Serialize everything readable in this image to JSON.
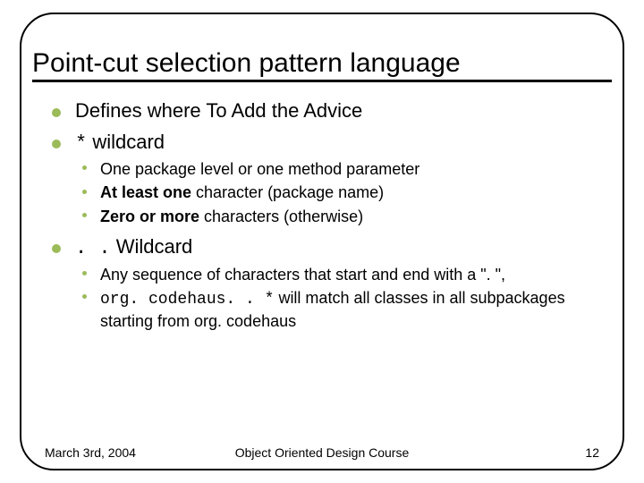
{
  "title": "Point-cut selection pattern language",
  "bullets": {
    "b1": "Defines where To Add the Advice",
    "b2_prefix_code": "*",
    "b2_rest": " wildcard",
    "b2_sub1": "One package level or one method parameter",
    "b2_sub2_strong": "At least one",
    "b2_sub2_rest": " character (package name)",
    "b2_sub3_strong": "Zero or more",
    "b2_sub3_rest": " characters (otherwise)",
    "b3_prefix_code": ". .",
    "b3_rest": " Wildcard",
    "b3_sub1": "Any sequence of characters that start and end with a \". \",",
    "b3_sub2_code": "org. codehaus. . *",
    "b3_sub2_rest": " will match all classes in all subpackages starting from org. codehaus"
  },
  "footer": {
    "date": "March 3rd, 2004",
    "course": "Object Oriented Design Course",
    "page": "12"
  }
}
